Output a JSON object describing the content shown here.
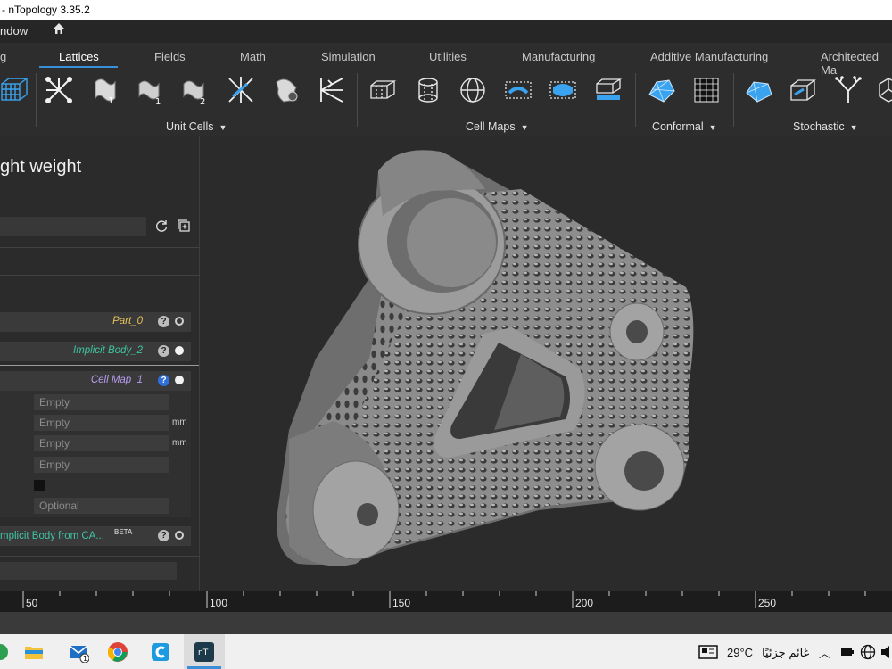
{
  "window": {
    "title": "- nTopology 3.35.2"
  },
  "menu": {
    "window_label": "ndow"
  },
  "ribbon": {
    "tabs": [
      {
        "label": "g"
      },
      {
        "label": "Lattices",
        "active": true
      },
      {
        "label": "Fields"
      },
      {
        "label": "Math"
      },
      {
        "label": "Simulation"
      },
      {
        "label": "Utilities"
      },
      {
        "label": "Manufacturing"
      },
      {
        "label": "Additive Manufacturing"
      },
      {
        "label": "Architected Ma"
      }
    ],
    "groups": [
      "Unit Cells",
      "Cell Maps",
      "Conformal",
      "Stochastic"
    ],
    "tool_icons": [
      "lattice-box-icon",
      "unit-cell-icon",
      "gyroid-icon",
      "tpms-1-icon",
      "tpms-2-icon",
      "strut-cell-icon",
      "graph-cell-icon",
      "beam-cell-icon",
      "rect-cell-map-icon",
      "cyl-cell-map-icon",
      "sph-cell-map-icon",
      "cell-map-surface-icon",
      "cell-map-volume-icon",
      "cell-map-slab-icon",
      "conformal-mesh-icon",
      "conformal-volume-icon",
      "stochastic-surface-icon",
      "stochastic-volume-icon",
      "tree-icon",
      "voronoi-icon"
    ],
    "accent": "#3a8fd9"
  },
  "panel": {
    "title": "ght weight",
    "blocks": [
      {
        "label": "Part_0",
        "color": "#e5c25a"
      },
      {
        "label": "Implicit Body_2",
        "color": "#3fc5a0"
      },
      {
        "label": "Cell Map_1",
        "color": "#b89cf0"
      }
    ],
    "fields": [
      {
        "value": "Empty",
        "unit": ""
      },
      {
        "value": "Empty",
        "unit": "mm"
      },
      {
        "value": "Empty",
        "unit": "mm"
      },
      {
        "value": "Empty",
        "unit": ""
      }
    ],
    "optional_placeholder": "Optional",
    "cad_block": {
      "label": "mplicit Body from CA...",
      "badge": "BETA",
      "color": "#3fc5a0"
    }
  },
  "ruler": {
    "ticks": [
      "50",
      "100",
      "150",
      "200",
      "250"
    ]
  },
  "taskbar": {
    "weather": "29°C",
    "weather_text": "غائم جزئيًا",
    "mail_badge": "1"
  }
}
